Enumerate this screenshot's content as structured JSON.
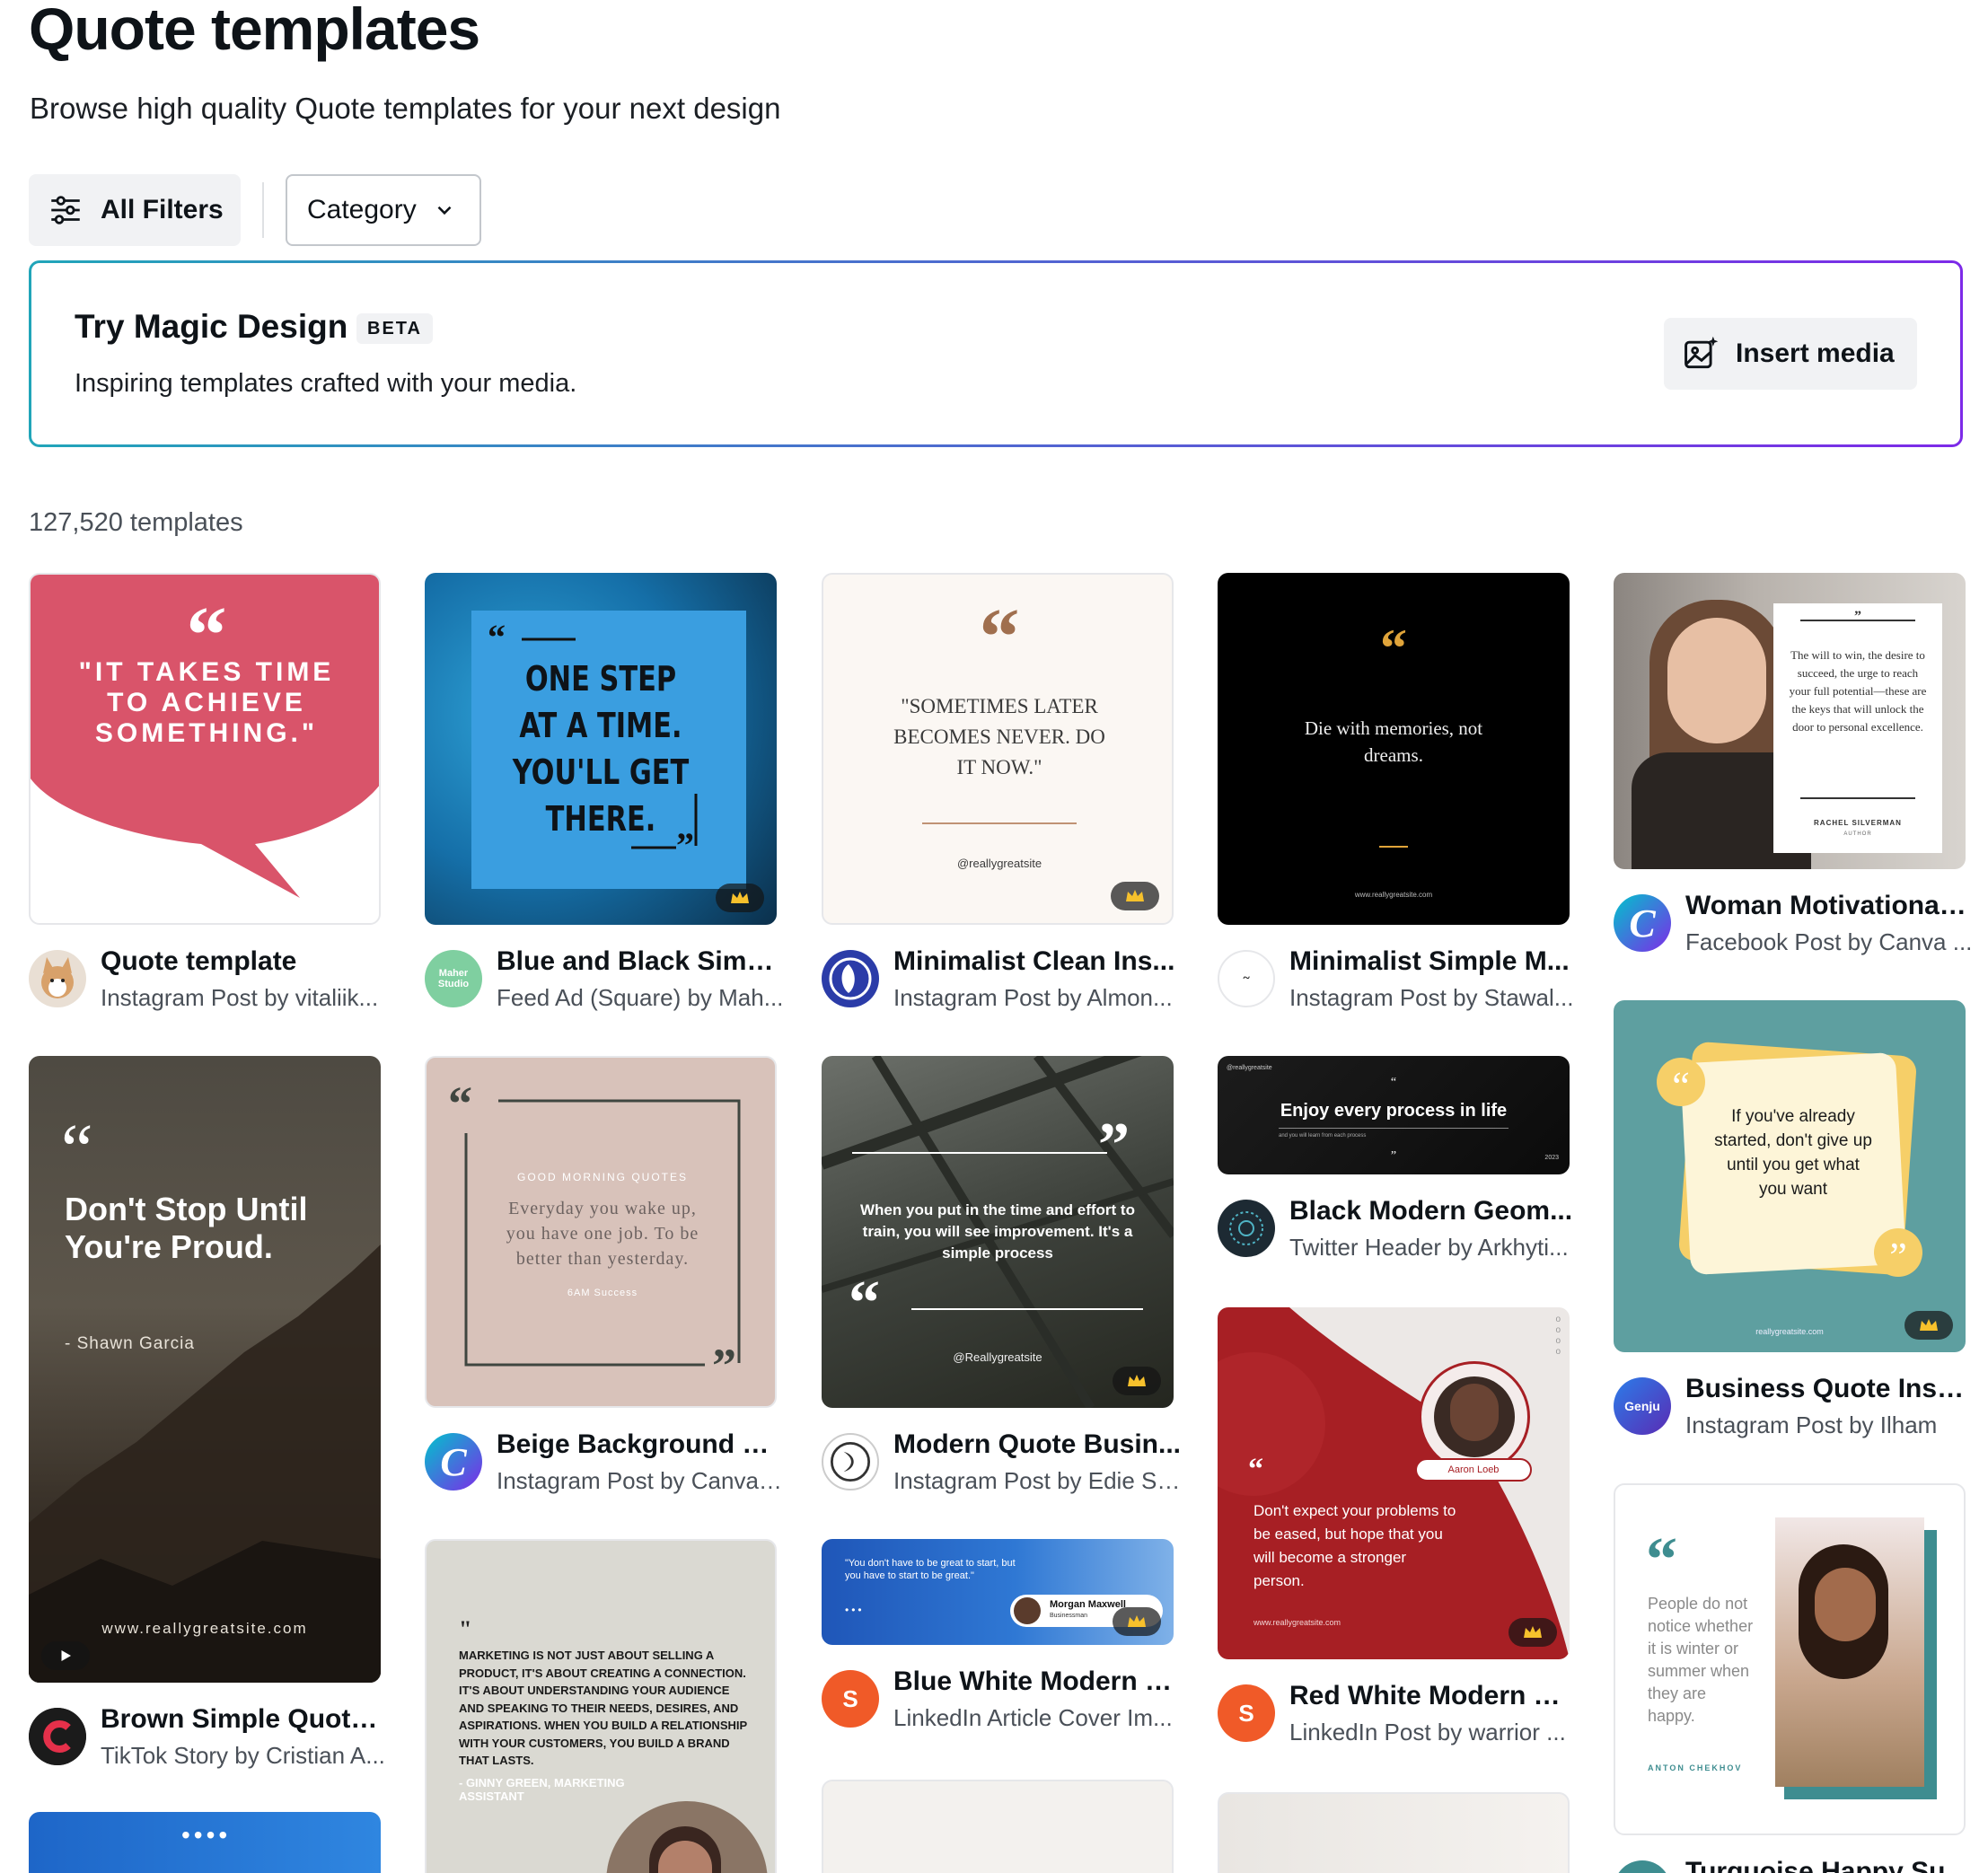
{
  "page": {
    "title": "Quote templates",
    "subtitle": "Browse high quality Quote templates for your next design"
  },
  "filters": {
    "all_filters_label": "All Filters",
    "category_label": "Category"
  },
  "magic_design": {
    "title": "Try Magic Design",
    "badge": "BETA",
    "subtitle": "Inspiring templates crafted with your media.",
    "button_label": "Insert media"
  },
  "results": {
    "count_label": "127,520 templates"
  },
  "cards": {
    "c1": {
      "title": "Quote template",
      "subtitle": "Instagram Post by vitaliik...",
      "thumb_quote": "\"IT TAKES TIME TO ACHIEVE SOMETHING.\""
    },
    "c2": {
      "title": "Blue and Black Simpl...",
      "subtitle": "Feed Ad (Square) by Mah...",
      "thumb_quote": "ONE STEP AT A TIME. YOU'LL GET THERE.",
      "avatar_text": "Maher Studio"
    },
    "c3": {
      "title": "Minimalist Clean Ins...",
      "subtitle": "Instagram Post by Almon...",
      "thumb_quote": "\"SOMETIMES LATER BECOMES NEVER. DO IT NOW.\"",
      "thumb_handle": "@reallygreatsite"
    },
    "c4": {
      "title": "Minimalist Simple M...",
      "subtitle": "Instagram Post by Stawal...",
      "thumb_quote": "Die with memories, not dreams.",
      "thumb_url": "www.reallygreatsite.com"
    },
    "c5": {
      "title": "Woman Motivational ...",
      "subtitle": "Facebook Post by Canva ...",
      "thumb_quote": "The will to win, the desire to succeed, the urge to reach your full potential—these are the keys that will unlock the door to personal excellence.",
      "thumb_author": "RACHEL SILVERMAN",
      "thumb_author_role": "AUTHOR"
    },
    "c6": {
      "title": "Brown Simple Quote ...",
      "subtitle": "TikTok Story by Cristian A...",
      "thumb_quote": "Don't Stop Until You're Proud.",
      "thumb_author": "- Shawn Garcia",
      "thumb_url": "www.reallygreatsite.com"
    },
    "c7": {
      "title": "Beige Background an...",
      "subtitle": "Instagram Post by Canva ...",
      "thumb_label": "GOOD MORNING QUOTES",
      "thumb_quote": "Everyday you wake up, you have one job. To be better than yesterday.",
      "thumb_brand": "6AM Success"
    },
    "c8": {
      "title": "Modern Quote Busin...",
      "subtitle": "Instagram Post by Edie St...",
      "thumb_quote": "When you put in the time and effort to train, you will see improvement. It's a simple process",
      "thumb_handle": "@Reallygreatsite"
    },
    "c9": {
      "title": "Black Modern Geom...",
      "subtitle": "Twitter Header by Arkhyti...",
      "thumb_quote": "Enjoy every process in life",
      "thumb_handle": "@reallygreatsite",
      "thumb_small": "and you will learn from each process",
      "thumb_year": "2023"
    },
    "c10": {
      "title": "Business Quote Insta...",
      "subtitle": "Instagram Post by Ilham",
      "thumb_quote": "If you've already started, don't give up until you get what you want",
      "thumb_url": "reallygreatsite.com",
      "avatar_text": "Genju"
    },
    "c11": {
      "title": "Blue White Modern G...",
      "subtitle": "LinkedIn Article Cover Im...",
      "thumb_quote": "\"You don't have to be great to start, but you have to start to be great.\"",
      "thumb_name": "Morgan Maxwell",
      "thumb_role": "Businessman",
      "avatar_text": "S"
    },
    "c12": {
      "title": "Red White Modern M...",
      "subtitle": "LinkedIn Post by warrior ...",
      "thumb_quote": "Don't expect your problems to be eased, but hope that you will become a stronger person.",
      "thumb_name": "Aaron Loeb",
      "thumb_url": "www.reallygreatsite.com",
      "avatar_text": "S"
    },
    "c13": {
      "thumb_quote": "MARKETING IS NOT JUST ABOUT SELLING A PRODUCT, IT'S ABOUT CREATING A CONNECTION. IT'S ABOUT UNDERSTANDING YOUR AUDIENCE AND SPEAKING TO THEIR NEEDS, DESIRES, AND ASPIRATIONS. WHEN YOU BUILD A RELATIONSHIP WITH YOUR CUSTOMERS, YOU BUILD A BRAND THAT LASTS.",
      "thumb_author": "- GINNY GREEN, MARKETING ASSISTANT"
    },
    "c14": {
      "title": "Turquoise Happy Su...",
      "thumb_quote": "People do not notice whether it is winter or summer when they are happy.",
      "thumb_author": "ANTON CHEKHOV"
    }
  },
  "colors": {
    "accent_teal": "#21a5b9",
    "accent_purple": "#7d2ae8",
    "canva_gradient_a": "#00c4cc",
    "canva_gradient_b": "#7d2ae8",
    "pink": "#d9546a",
    "orange_avatar": "#f05a28"
  },
  "icons": {
    "filters": "sliders-icon",
    "category": "chevron-down-icon",
    "insert": "image-sparkle-icon",
    "premium": "crown-icon",
    "video": "play-icon"
  }
}
